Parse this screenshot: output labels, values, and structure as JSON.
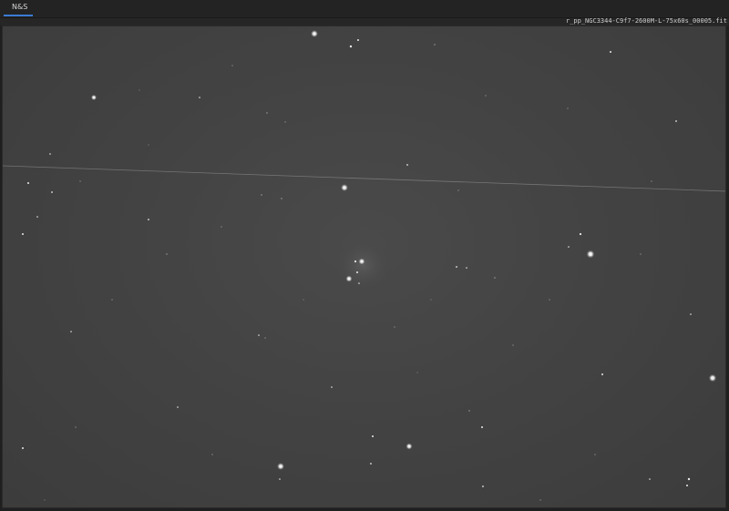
{
  "tabs": [
    {
      "label": "N&S",
      "active": true
    }
  ],
  "colors": {
    "active_tab_underline": "#3a7bd5",
    "sky_background": "#434343",
    "star": "#f2f2f2",
    "satellite_trail": "#8a8a8a"
  },
  "viewer": {
    "filename": "r_pp_NGC3344-C9f7-2600M-L-75x60s_00005.fit"
  }
}
